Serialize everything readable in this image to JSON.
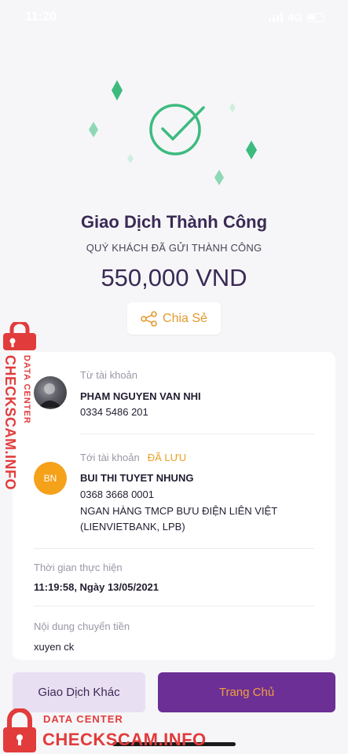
{
  "status_bar": {
    "time": "11:20",
    "network": "4G"
  },
  "result": {
    "title": "Giao Dịch Thành Công",
    "subtitle": "QUÝ KHÁCH ĐÃ GỬI THÀNH CÔNG",
    "amount": "550,000 VND",
    "share_label": "Chia Sẻ"
  },
  "details": {
    "from": {
      "label": "Từ tài khoản",
      "name": "PHAM NGUYEN VAN NHI",
      "account": "0334 5486 201"
    },
    "to": {
      "label": "Tới tài khoản",
      "saved_tag": "ĐÃ LƯU",
      "avatar_initials": "BN",
      "name": "BUI THI TUYET NHUNG",
      "account": "0368 3668 0001",
      "bank_line1": "NGAN HÀNG TMCP BƯU ĐIỆN LIÊN VIỆT",
      "bank_line2": "(LIENVIETBANK,  LPB)"
    },
    "time": {
      "label": "Thời gian thực hiện",
      "value": "11:19:58, Ngày 13/05/2021"
    },
    "content": {
      "label": "Nội dung chuyển tiền",
      "value": "xuyen ck"
    }
  },
  "actions": {
    "other": "Giao Dịch Khác",
    "home": "Trang Chủ"
  },
  "watermark": {
    "small": "DATA CENTER",
    "big": "CHECKSCAM.INFO"
  },
  "colors": {
    "accent_purple": "#6c2f96",
    "success_green": "#3dbb7f",
    "orange": "#e39a2d",
    "watermark_red": "#e23b3b"
  }
}
